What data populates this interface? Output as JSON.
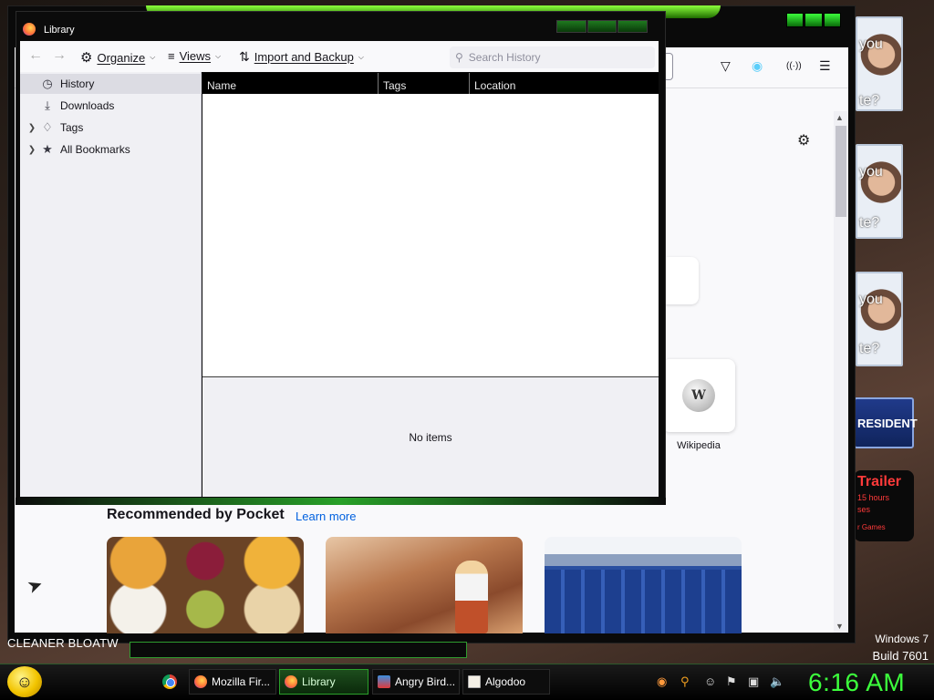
{
  "library": {
    "title": "Library",
    "toolbar": {
      "organize": "Organize",
      "views": "Views",
      "import_backup": "Import and Backup"
    },
    "search": {
      "placeholder": "Search History"
    },
    "sidebar": [
      {
        "label": "History",
        "icon": "clock-icon",
        "selected": true
      },
      {
        "label": "Downloads",
        "icon": "download-icon"
      },
      {
        "label": "Tags",
        "icon": "tag-icon",
        "expandable": true
      },
      {
        "label": "All Bookmarks",
        "icon": "star-icon",
        "expandable": true
      }
    ],
    "columns": [
      "Name",
      "Tags",
      "Location"
    ],
    "details_text": "No items"
  },
  "firefox": {
    "shortcut_label": "Wikipedia",
    "pocket_title": "Recommended by Pocket",
    "pocket_learn_more": "Learn more"
  },
  "desktop": {
    "side_text": [
      "you",
      "te?",
      "you",
      "te?",
      "you",
      "te?"
    ],
    "president": "RESIDENT",
    "trailer": "Trailer",
    "trailer_sub": "15 hours",
    "trailer_sub2": "ses",
    "trailer_games": "r Games",
    "os_name": "Windows 7",
    "build": "Build 7601",
    "strip_text": "CLEANER   BLOATW"
  },
  "taskbar": {
    "tasks": [
      "Mozilla Fir...",
      "Library",
      "Angry Bird...",
      "Algodoo"
    ],
    "clock": "6:16 AM"
  },
  "colors": {
    "accent_green": "#3cff3c",
    "firefox_blue": "#0060df"
  }
}
